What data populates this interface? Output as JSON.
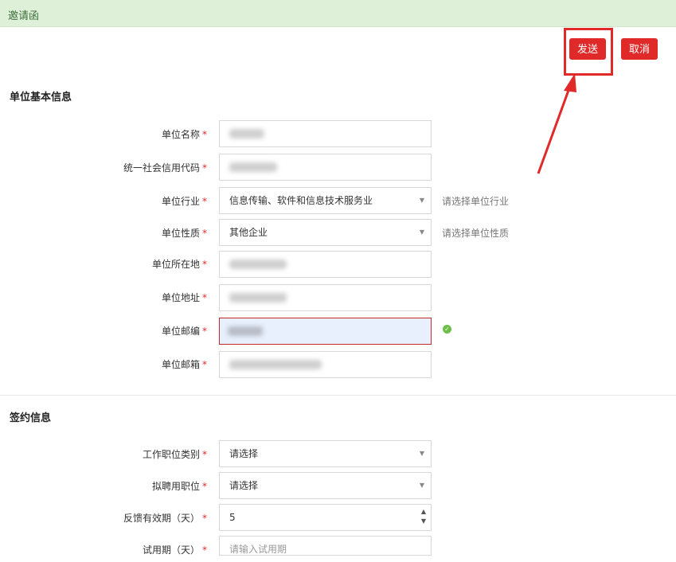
{
  "header": {
    "title": "邀请函"
  },
  "toolbar": {
    "send_label": "发送",
    "cancel_label": "取消"
  },
  "section_company": {
    "title": "单位基本信息",
    "fields": [
      {
        "label": "单位名称",
        "value": "",
        "type": "text"
      },
      {
        "label": "统一社会信用代码",
        "value": "",
        "type": "text"
      },
      {
        "label": "单位行业",
        "value": "信息传输、软件和信息技术服务业",
        "type": "select",
        "hint": "请选择单位行业"
      },
      {
        "label": "单位性质",
        "value": "其他企业",
        "type": "select",
        "hint": "请选择单位性质"
      },
      {
        "label": "单位所在地",
        "value": "",
        "type": "text"
      },
      {
        "label": "单位地址",
        "value": "",
        "type": "text"
      },
      {
        "label": "单位邮编",
        "value": "",
        "type": "text",
        "valid": true
      },
      {
        "label": "单位邮箱",
        "value": "",
        "type": "text"
      }
    ]
  },
  "section_contract": {
    "title": "签约信息",
    "fields": [
      {
        "label": "工作职位类别",
        "value": "请选择",
        "type": "select"
      },
      {
        "label": "拟聘用职位",
        "value": "请选择",
        "type": "select"
      },
      {
        "label": "反馈有效期（天）",
        "value": "5",
        "type": "number"
      },
      {
        "label": "试用期（天）",
        "value": "",
        "placeholder": "请输入试用期",
        "type": "text"
      }
    ]
  },
  "required_mark": "*",
  "colors": {
    "accent": "#e02a2a",
    "header_bg": "#dff0d8",
    "valid": "#6cc04a"
  }
}
